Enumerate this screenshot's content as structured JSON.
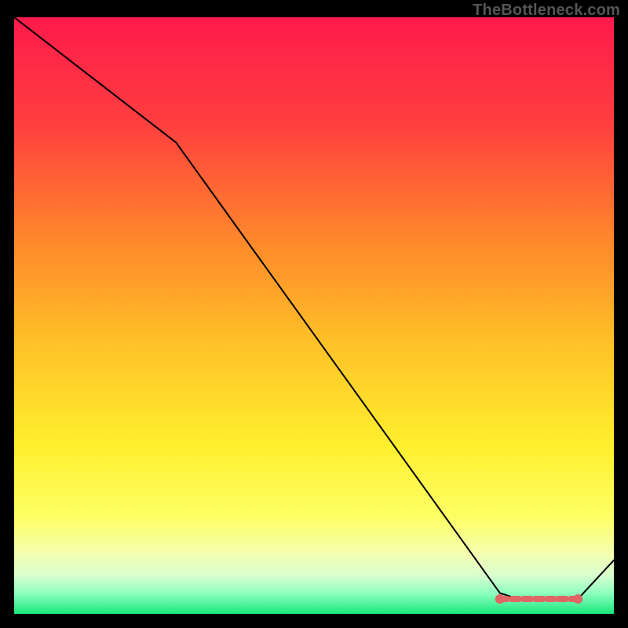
{
  "watermark": "TheBottleneck.com",
  "chart_data": {
    "type": "line",
    "title": "",
    "xlabel": "",
    "ylabel": "",
    "xlim": [
      0,
      100
    ],
    "ylim": [
      0,
      100
    ],
    "x": [
      0,
      27,
      81,
      84,
      94,
      100
    ],
    "values": [
      100,
      79,
      3.5,
      2.5,
      2.5,
      9
    ],
    "marker_band": {
      "start_x": 81,
      "end_x": 94,
      "y": 2.5,
      "color": "#e06666"
    },
    "gradient_stops": [
      {
        "offset": 0.0,
        "color": "#ff1a4b"
      },
      {
        "offset": 0.18,
        "color": "#ff3f3f"
      },
      {
        "offset": 0.38,
        "color": "#ff8a2a"
      },
      {
        "offset": 0.55,
        "color": "#ffc228"
      },
      {
        "offset": 0.72,
        "color": "#fff02e"
      },
      {
        "offset": 0.84,
        "color": "#fdff66"
      },
      {
        "offset": 0.9,
        "color": "#f4ffb0"
      },
      {
        "offset": 0.935,
        "color": "#d9ffcf"
      },
      {
        "offset": 0.965,
        "color": "#8fffc0"
      },
      {
        "offset": 1.0,
        "color": "#18e87a"
      }
    ]
  }
}
